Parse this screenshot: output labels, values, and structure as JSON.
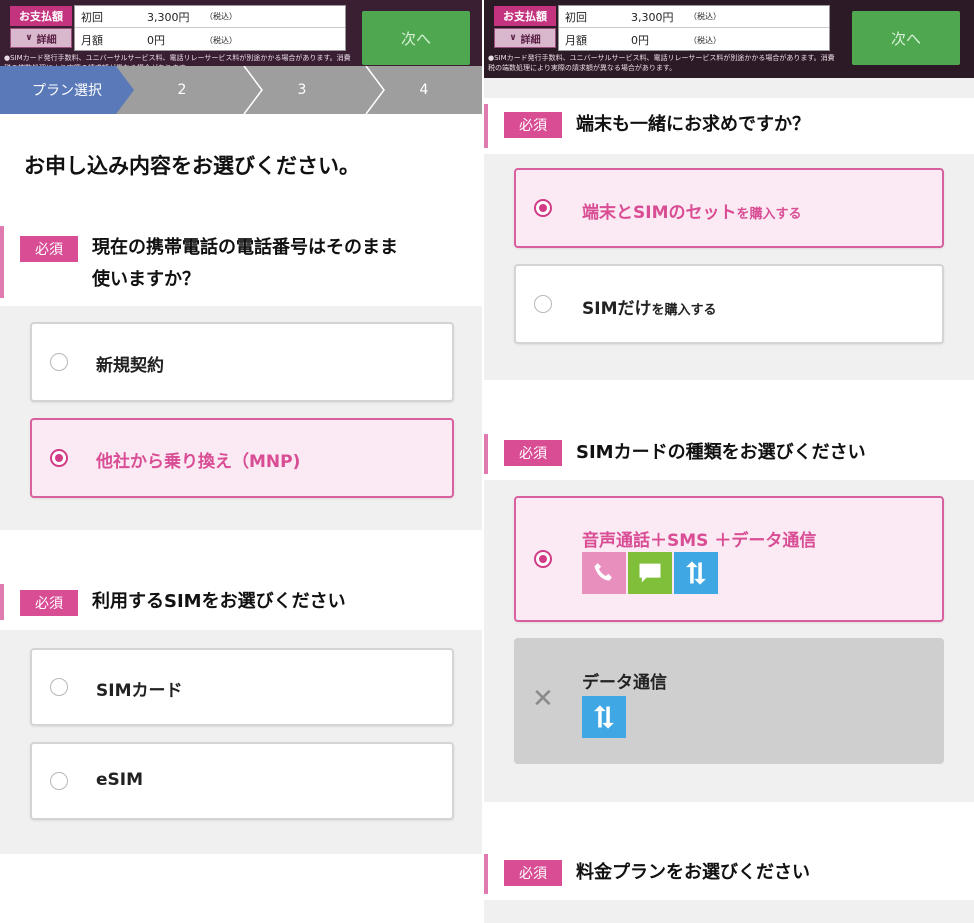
{
  "payment_bar": {
    "pay_label": "お支払額",
    "detail_label": "詳細",
    "initial_label": "初回",
    "initial_amount": "3,300円",
    "initial_tax": "（税込）",
    "monthly_label": "月額",
    "monthly_amount": "0円",
    "monthly_tax": "（税込）",
    "note": "●SIMカード発行手数料、ユニバーサルサービス料、電話リレーサービス料が別途かかる場合があります。消費税の端数処理により実際の請求額が異なる場合があります。",
    "next_label": "次へ"
  },
  "steps": [
    "プラン選択",
    "2",
    "3",
    "4"
  ],
  "page_title": "お申し込み内容をお選びください。",
  "required_badge": "必須",
  "questions": {
    "number": {
      "text_line1": "現在の携帯電話の電話番号はそのまま",
      "text_line2": "使いますか？",
      "options": [
        "新規契約",
        "他社から乗り換え（MNP)"
      ],
      "selected": 1
    },
    "sim": {
      "text": "利用するSIMをお選びください",
      "options": [
        "SIMカード",
        "eSIM"
      ],
      "selected": null
    },
    "device": {
      "text": "端末も一緒にお求めですか？",
      "option1_main": "端末とSIMのセット",
      "option1_small": "を購入する",
      "option2_main": "SIMだけ",
      "option2_small": "を購入する",
      "selected": 0
    },
    "sim_type": {
      "text": "SIMカードの種類をお選びください",
      "options": [
        "音声通話＋SMS ＋データ通信",
        "データ通信"
      ],
      "icons_option1": [
        "phone-icon",
        "message-icon",
        "data-transfer-icon"
      ],
      "icons_option2": [
        "data-transfer-icon"
      ],
      "selected": 0,
      "disabled": [
        1
      ]
    },
    "plan": {
      "text": "料金プランをお選びください"
    }
  },
  "colors": {
    "accent_pink": "#d94d95",
    "selected_bg": "#fbeaf3",
    "next_green": "#4fa84f",
    "step_active": "#5a79b8",
    "icon_phone": "#e98fbe",
    "icon_chat": "#7fbf3a",
    "icon_data": "#3fa7e3"
  }
}
